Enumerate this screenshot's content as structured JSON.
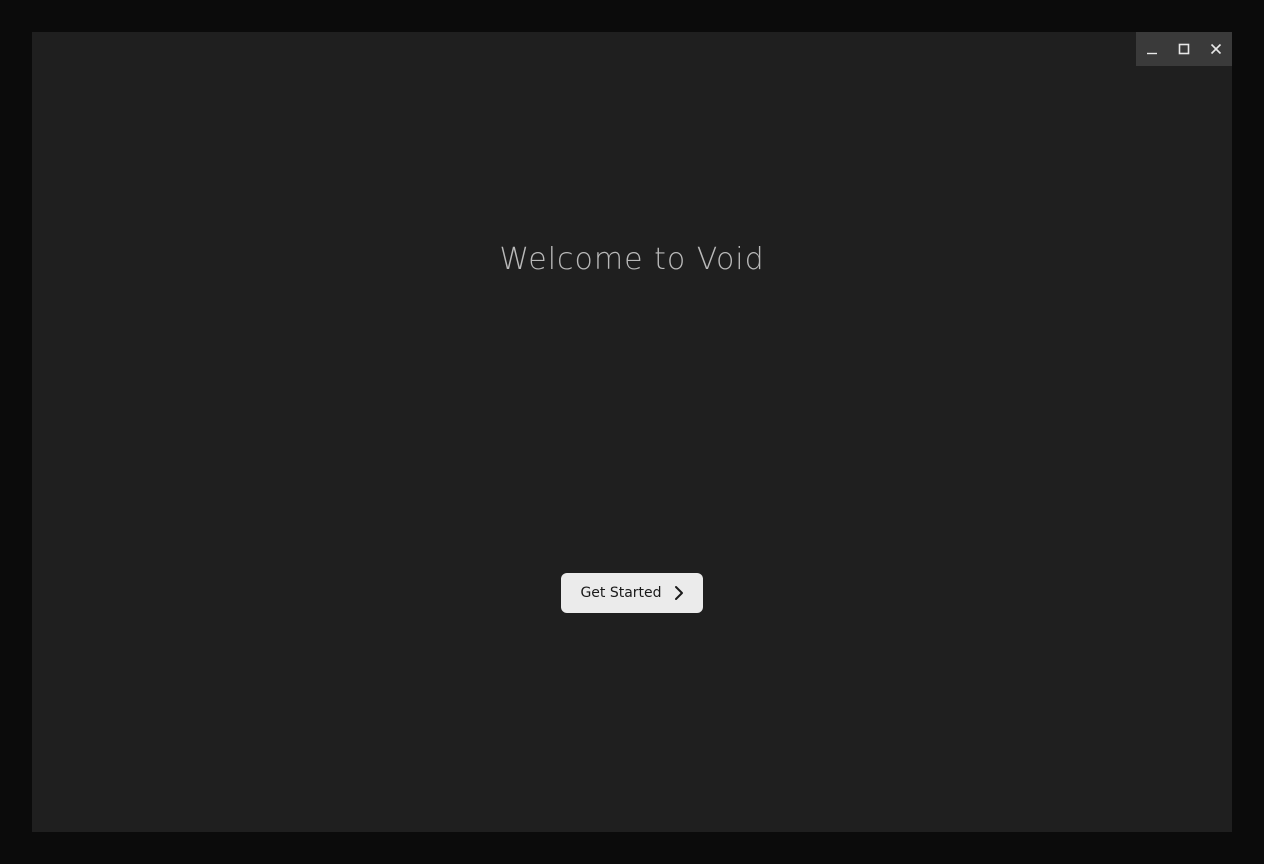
{
  "window": {
    "controls": {
      "minimize_icon": "minimize-icon",
      "maximize_icon": "maximize-icon",
      "close_icon": "close-icon"
    }
  },
  "welcome": {
    "title": "Welcome to Void",
    "button_label": "Get Started",
    "button_icon": "chevron-right-icon"
  },
  "colors": {
    "outer_background": "#0b0b0b",
    "window_background": "#1f1f1f",
    "controls_background": "#3a3a3a",
    "title_text": "#b9b9b9",
    "button_background": "#ebebeb",
    "button_text": "#1a1a1a"
  }
}
